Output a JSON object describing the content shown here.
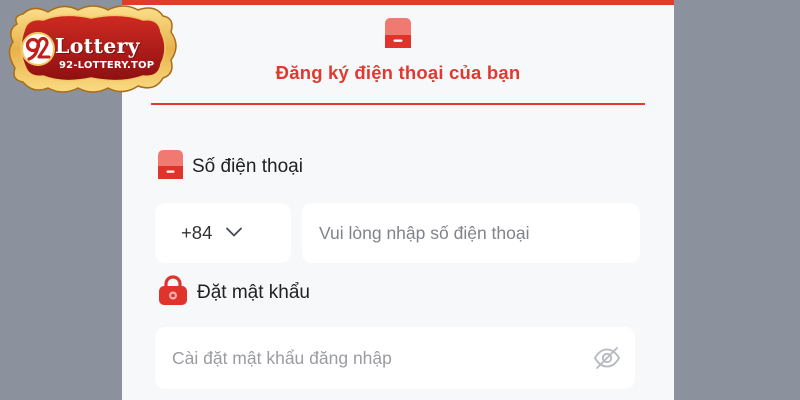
{
  "logo": {
    "title": "Lottery",
    "subtitle": "92-LOTTERY.TOP",
    "mark_icon": "92-monogram-icon"
  },
  "form": {
    "title": "Đăng ký điện thoại của bạn",
    "header_icon": "phone-icon",
    "phone": {
      "label": "Số điện thoại",
      "icon": "phone-icon",
      "country_code": "+84",
      "dropdown_icon": "chevron-down-icon",
      "placeholder": "Vui lòng nhập số điện thoại",
      "value": ""
    },
    "password": {
      "label": "Đặt mật khẩu",
      "icon": "lock-icon",
      "placeholder": "Cài đặt mật khẩu đăng nhập",
      "value": "",
      "toggle_icon": "eye-off-icon"
    }
  },
  "colors": {
    "accent": "#e23a2f",
    "page_background": "#8b919d",
    "panel_background": "#f7f8fa",
    "input_background": "#ffffff",
    "logo_gold": "#f3c766",
    "logo_red": "#b3191b"
  }
}
